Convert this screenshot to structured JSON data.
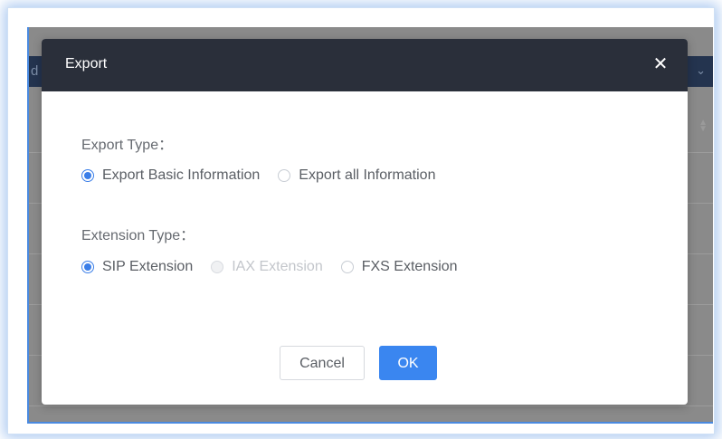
{
  "background": {
    "header_left_text": "d",
    "header_right_icon": "chevron-down-icon"
  },
  "dialog": {
    "title": "Export",
    "close_icon": "close-icon",
    "close_glyph": "✕",
    "export_type": {
      "label": "Export Type：",
      "options": [
        {
          "label": "Export Basic Information",
          "selected": true,
          "disabled": false
        },
        {
          "label": "Export all Information",
          "selected": false,
          "disabled": false
        }
      ]
    },
    "extension_type": {
      "label": "Extension Type：",
      "options": [
        {
          "label": "SIP Extension",
          "selected": true,
          "disabled": false
        },
        {
          "label": "IAX Extension",
          "selected": false,
          "disabled": true
        },
        {
          "label": "FXS Extension",
          "selected": false,
          "disabled": false
        }
      ]
    },
    "buttons": {
      "cancel": "Cancel",
      "ok": "OK"
    }
  },
  "colors": {
    "accent": "#3a86f0",
    "header_bg": "#2a2f3a"
  }
}
